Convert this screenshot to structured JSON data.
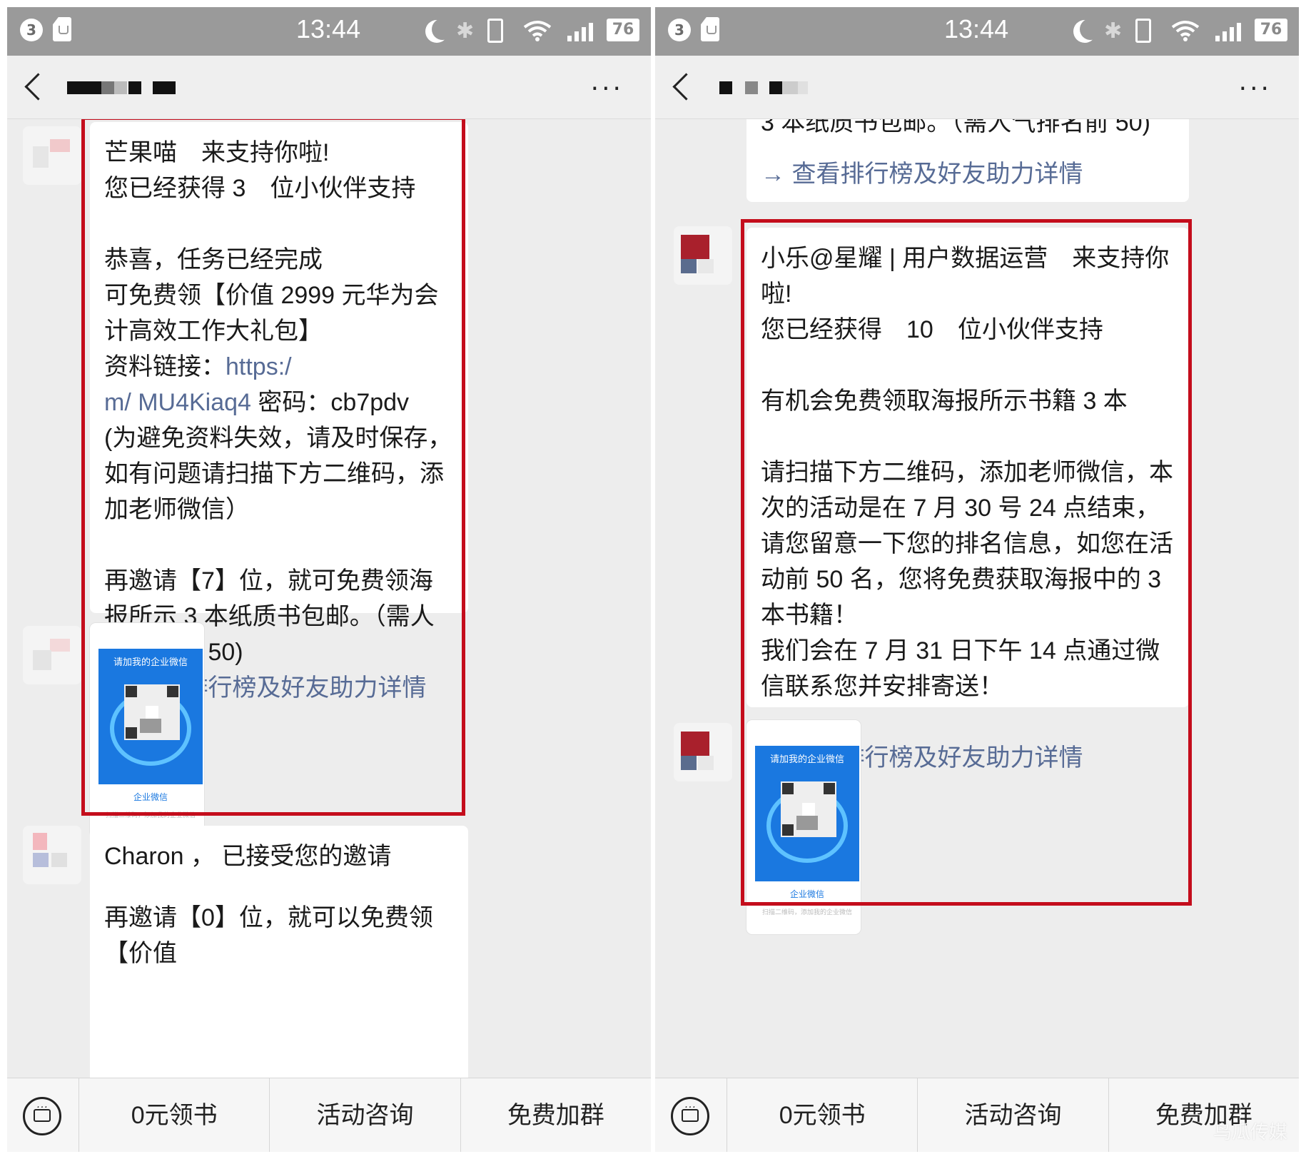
{
  "status_bar": {
    "badge": "3",
    "time": "13:44",
    "battery": "76"
  },
  "colors": {
    "highlight_border": "#c40d1c",
    "link": "#576b95",
    "qr_blue": "#1a78e0"
  },
  "left": {
    "messages": [
      {
        "lines": [
          "芒果喵　来支持你啦!",
          "您已经获得 3　位小伙伴支持"
        ],
        "lines2": [
          "恭喜，任务已经完成",
          "可免费领【价值 2999 元华为会计高效工作大礼包】"
        ],
        "link_label": "资料链接：",
        "link_text": "https:/　　　　　　　　　　m/ MU4Kiaq4",
        "password": " 密码：cb7pdv",
        "note": "(为避免资料失效，请及时保存，如有问题请扫描下方二维码，添加老师微信）",
        "invite": "再邀请【7】位，就可免费领海报所示 3 本纸质书包邮。（需人气排名前 50)",
        "detail_link": "→ 查看排行榜及好友助力详情"
      },
      {
        "line1": "Charon ， 已接受您的邀请",
        "line2": "再邀请【0】位，就可以免费领【价值"
      }
    ],
    "qr": {
      "title": "请加我的企业微信",
      "brand": "企业微信",
      "footer": "扫描二维码，添加我的企业微信"
    }
  },
  "right": {
    "messages": [
      {
        "partial_line": "3 本纸质书包邮。（需人气排名前 50)",
        "detail_link": "→ 查看排行榜及好友助力详情"
      },
      {
        "line1": "小乐@星耀 | 用户数据运营　来支持你啦!",
        "line2": "您已经获得　10　位小伙伴支持",
        "line3": "有机会免费领取海报所示书籍 3 本",
        "body": "请扫描下方二维码，添加老师微信，本次的活动是在 7 月 30 号 24 点结束，请您留意一下您的排名信息，如您在活动前 50 名，您将免费获取海报中的 3 本书籍！",
        "body2": "我们会在 7 月 31 日下午 14 点通过微信联系您并安排寄送！",
        "detail_link": "→ 查看排行榜及好友助力详情"
      }
    ],
    "qr": {
      "title": "请加我的企业微信",
      "brand": "企业微信",
      "footer": "扫描二维码，添加我的企业微信"
    }
  },
  "bottom_menu": [
    "0元领书",
    "活动咨询",
    "免费加群"
  ],
  "watermark": "鸟瓜传媒"
}
